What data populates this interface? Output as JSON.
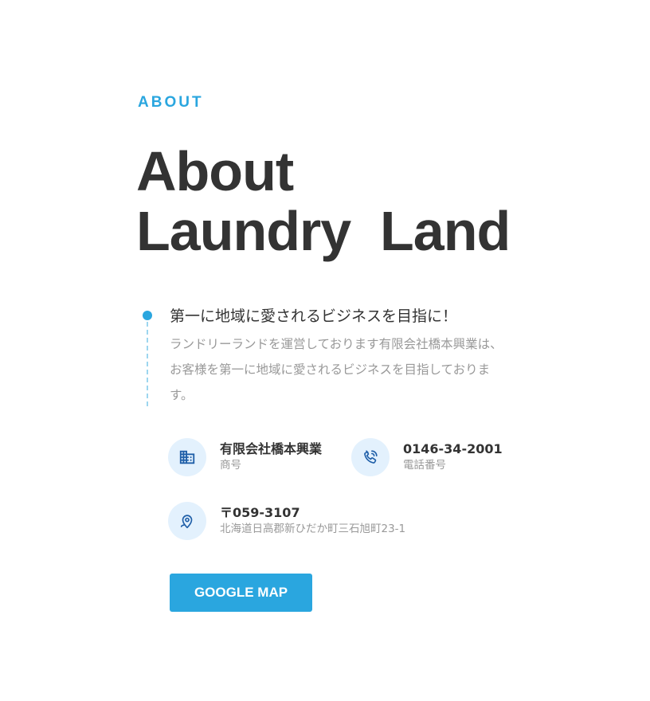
{
  "section": {
    "eyebrow": "ABOUT",
    "heading_line1": "About",
    "heading_line2": "Laundry  Land"
  },
  "intro": {
    "title": "第一に地域に愛されるビジネスを目指に！",
    "text": "ランドリーランドを運営しております有限会社橋本興業は、お客様を第一に地域に愛されるビジネスを目指しております。"
  },
  "info": {
    "company": {
      "icon": "building-icon",
      "value": "有限会社橋本興業",
      "label": "商号"
    },
    "phone": {
      "icon": "phone-icon",
      "value": "0146-34-2001",
      "label": "電話番号"
    },
    "address": {
      "icon": "map-pin-icon",
      "value": "〒059-3107",
      "label": "北海道日高郡新ひだか町三石旭町23-1"
    }
  },
  "button": {
    "label": "GOOGLE MAP"
  },
  "colors": {
    "accent": "#2aa6df",
    "heading": "#333333",
    "muted": "#999999",
    "icon_bg": "#e3f1fd",
    "icon": "#1f5fa8"
  }
}
